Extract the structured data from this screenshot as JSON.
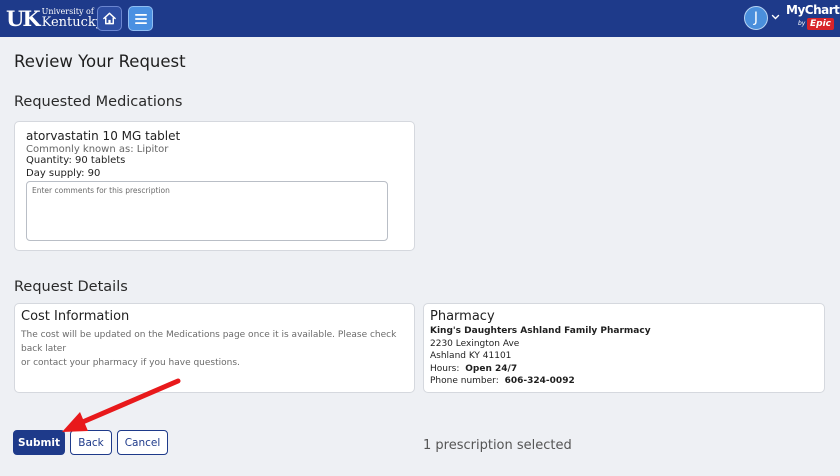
{
  "header": {
    "logo_line1": "University of",
    "logo_line2": "Kentucky.",
    "logo_mark": "UK",
    "user_initial": "J",
    "brand_mychart": "MyChart",
    "brand_by": "by",
    "brand_epic": "Epic",
    "icons": [
      "home-icon",
      "menu-icon",
      "chevron-down-icon"
    ]
  },
  "page": {
    "title": "Review Your Request"
  },
  "medications_section": {
    "title": "Requested Medications",
    "items": [
      {
        "name": "atorvastatin 10 MG tablet",
        "common_name": "Commonly known as: Lipitor",
        "quantity": "Quantity: 90 tablets",
        "day_supply": "Day supply: 90",
        "comment_placeholder": "Enter comments for this prescription",
        "comment_value": ""
      }
    ]
  },
  "details_section": {
    "title": "Request Details",
    "cost": {
      "title": "Cost Information",
      "text_line1": "The cost will be updated on the Medications page once it is available. Please check back later",
      "text_line2": "or contact your pharmacy if you have questions."
    },
    "pharmacy": {
      "title": "Pharmacy",
      "name": "King's Daughters Ashland Family Pharmacy",
      "address1": "2230 Lexington Ave",
      "address2": "Ashland KY 41101",
      "hours_label": "Hours:",
      "hours_value": "Open 24/7",
      "phone_label": "Phone number:",
      "phone_value": "606-324-0092"
    }
  },
  "actions": {
    "submit_label": "Submit",
    "back_label": "Back",
    "cancel_label": "Cancel",
    "selected_text": "1 prescription selected"
  },
  "colors": {
    "header_bg": "#1e3a8a",
    "primary": "#1e3a8a",
    "menu_button": "#4a90e2",
    "epic_red": "#d8232a",
    "annotation_arrow": "#e8191b",
    "page_bg": "#eef0f4"
  }
}
